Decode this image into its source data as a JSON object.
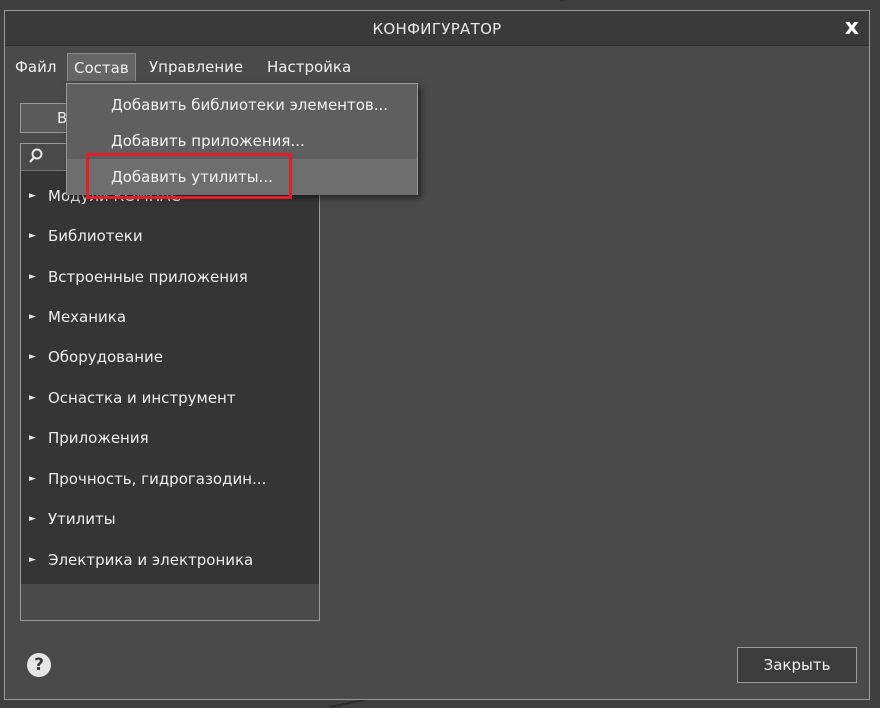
{
  "window": {
    "title": "КОНФИГУРАТОР",
    "close_symbol": "x"
  },
  "menu": {
    "items": [
      {
        "label": "Файл"
      },
      {
        "label": "Состав"
      },
      {
        "label": "Управление"
      },
      {
        "label": "Настройка"
      }
    ],
    "active": "Состав"
  },
  "dropdown": {
    "items": [
      {
        "label": "Добавить библиотеки элементов..."
      },
      {
        "label": "Добавить приложения..."
      },
      {
        "label": "Добавить утилиты..."
      }
    ],
    "highlighted": "Добавить утилиты..."
  },
  "left_button": {
    "label": "В"
  },
  "search": {
    "icon": "search-icon",
    "value": ""
  },
  "tree": {
    "items": [
      {
        "label": "Модули КОМПАС"
      },
      {
        "label": "Библиотеки"
      },
      {
        "label": "Встроенные приложения"
      },
      {
        "label": "Механика"
      },
      {
        "label": "Оборудование"
      },
      {
        "label": "Оснастка и инструмент"
      },
      {
        "label": "Приложения"
      },
      {
        "label": "Прочность, гидрогазодин..."
      },
      {
        "label": "Утилиты"
      },
      {
        "label": "Электрика и электроника"
      }
    ],
    "arrow": "►"
  },
  "help": {
    "symbol": "?"
  },
  "footer": {
    "close_label": "Закрыть"
  },
  "colors": {
    "highlight": "#e01f27",
    "window_bg": "#4a4a4a",
    "tree_bg": "#353535"
  }
}
